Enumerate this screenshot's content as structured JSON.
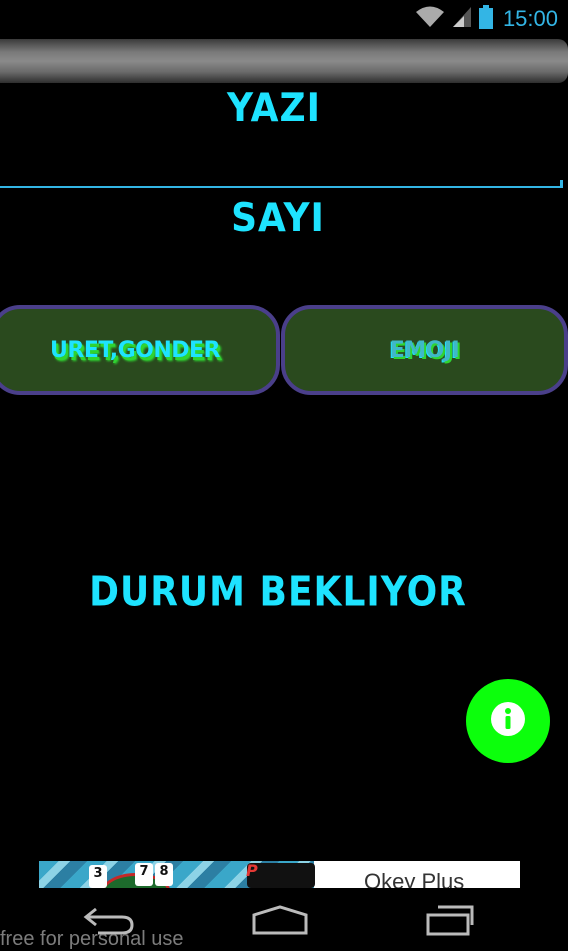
{
  "status_bar": {
    "time": "15:00",
    "icons": [
      "wifi-icon",
      "signal-icon",
      "battery-icon"
    ]
  },
  "form": {
    "text_label": "YAZI",
    "text_input_value": "",
    "number_label": "SAYI"
  },
  "buttons": {
    "generate_send": "URET,GONDER",
    "emoji": "EMOJI"
  },
  "status": {
    "message": "DURUM BEKLIYOR"
  },
  "fab": {
    "icon": "info-icon"
  },
  "ad": {
    "title": "Okey Plus",
    "tiles": [
      "3",
      "7",
      "8"
    ],
    "logo_letter": "P"
  },
  "nav": {
    "icons": [
      "back-icon",
      "home-icon",
      "recent-apps-icon"
    ]
  },
  "watermark": "free for personal use",
  "colors": {
    "accent": "#1ee3ff",
    "button_bg": "#2a4a1e",
    "button_border": "#4a3f8a",
    "fab": "#0cff0c",
    "input_line": "#33b5e5"
  }
}
